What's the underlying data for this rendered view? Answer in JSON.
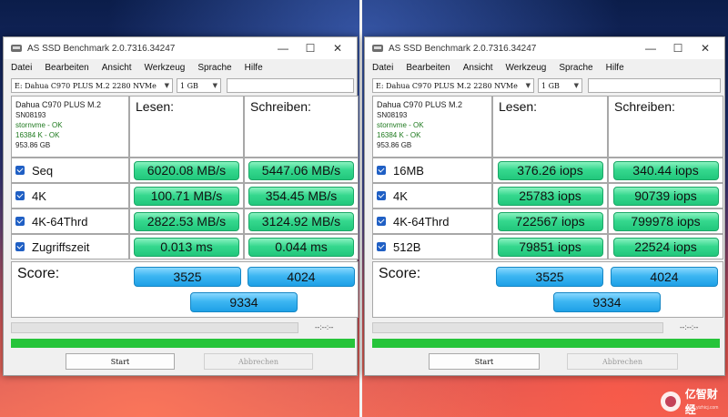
{
  "windows": [
    {
      "title": "AS SSD Benchmark 2.0.7316.34247",
      "menu": [
        "Datei",
        "Bearbeiten",
        "Ansicht",
        "Werkzeug",
        "Sprache",
        "Hilfe"
      ],
      "drive_select": "E: Dahua C970 PLUS M.2 2280 NVMe",
      "size_select": "1 GB",
      "drive_info": {
        "name": "Dahua C970 PLUS M.2",
        "serial": "SN08193",
        "driver": "stornvme - OK",
        "align": "16384 K - OK",
        "capacity": "953.86 GB"
      },
      "col_read": "Lesen:",
      "col_write": "Schreiben:",
      "rows": [
        {
          "label": "Seq",
          "read": "6020.08 MB/s",
          "write": "5447.06 MB/s"
        },
        {
          "label": "4K",
          "read": "100.71 MB/s",
          "write": "354.45 MB/s"
        },
        {
          "label": "4K-64Thrd",
          "read": "2822.53 MB/s",
          "write": "3124.92 MB/s"
        },
        {
          "label": "Zugriffszeit",
          "read": "0.013 ms",
          "write": "0.044 ms"
        }
      ],
      "score_label": "Score:",
      "score_read": "3525",
      "score_write": "4024",
      "score_total": "9334",
      "time_text": "--:--:--",
      "start_button": "Start",
      "cancel_button": "Abbrechen"
    },
    {
      "title": "AS SSD Benchmark 2.0.7316.34247",
      "menu": [
        "Datei",
        "Bearbeiten",
        "Ansicht",
        "Werkzeug",
        "Sprache",
        "Hilfe"
      ],
      "drive_select": "E: Dahua C970 PLUS M.2 2280 NVMe",
      "size_select": "1 GB",
      "drive_info": {
        "name": "Dahua C970 PLUS M.2",
        "serial": "SN08193",
        "driver": "stornvme - OK",
        "align": "16384 K - OK",
        "capacity": "953.86 GB"
      },
      "col_read": "Lesen:",
      "col_write": "Schreiben:",
      "rows": [
        {
          "label": "16MB",
          "read": "376.26 iops",
          "write": "340.44 iops"
        },
        {
          "label": "4K",
          "read": "25783 iops",
          "write": "90739 iops"
        },
        {
          "label": "4K-64Thrd",
          "read": "722567 iops",
          "write": "799978 iops"
        },
        {
          "label": "512B",
          "read": "79851 iops",
          "write": "22524 iops"
        }
      ],
      "score_label": "Score:",
      "score_read": "3525",
      "score_write": "4024",
      "score_total": "9334",
      "time_text": "--:--:--",
      "start_button": "Start",
      "cancel_button": "Abbrechen"
    }
  ],
  "watermark": {
    "text": "亿智财经",
    "subtext": "www.yizhicj.com"
  },
  "colors": {
    "value_green": "#35d88e",
    "score_blue": "#3db6f2",
    "progress_green": "#26c43a",
    "checkbox_blue": "#1f5fc4"
  }
}
